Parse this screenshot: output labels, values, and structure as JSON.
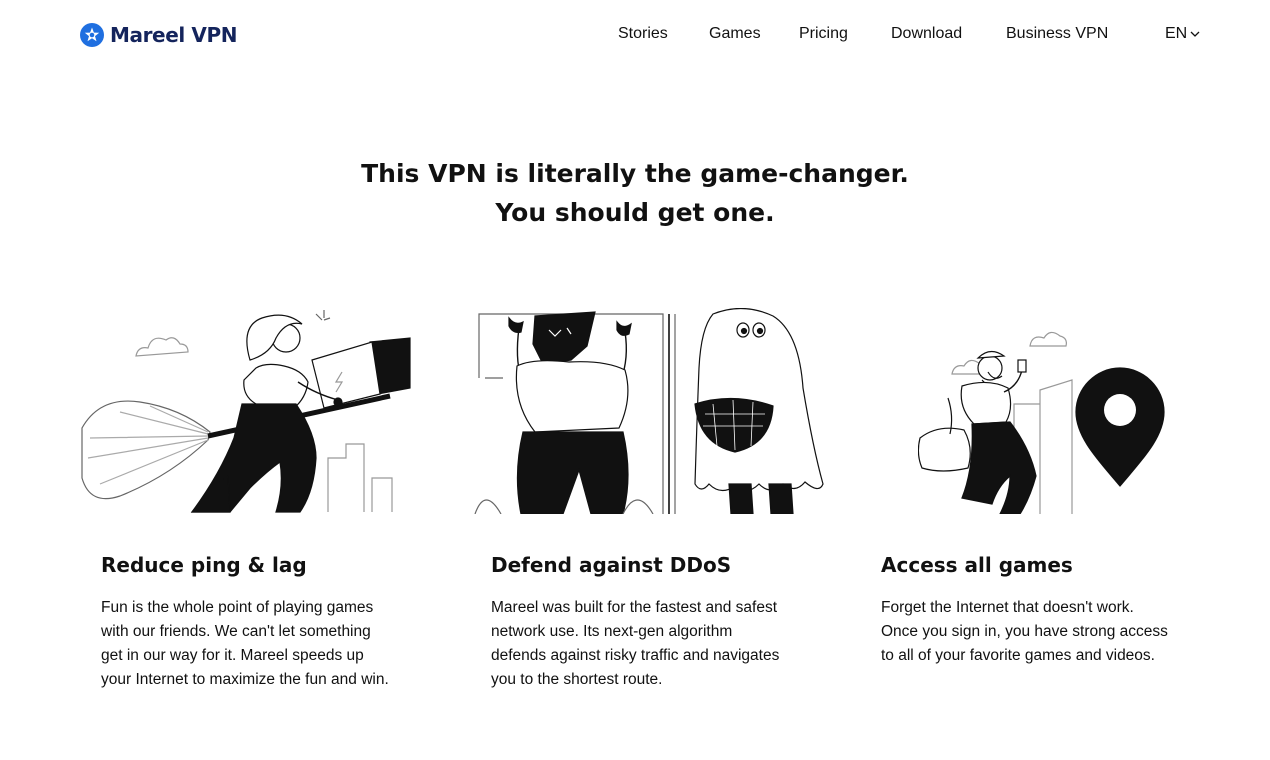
{
  "brand": {
    "name": "Mareel VPN",
    "logo_icon": "star-badge-icon",
    "color": "#1f6fe0",
    "text_color": "#14245c"
  },
  "nav": {
    "items": [
      "Stories",
      "Games",
      "Pricing",
      "Download",
      "Business VPN"
    ],
    "language": "EN",
    "language_icon": "chevron-down-icon"
  },
  "hero": {
    "line1": "This VPN is literally the game-changer.",
    "line2": "You should get one."
  },
  "features": [
    {
      "illustration": "witch-on-broom-illustration",
      "title": "Reduce ping & lag",
      "lines": [
        "Fun is the whole point of playing games",
        "with our friends. We can't let something",
        "get in our way for it. Mareel speeds up",
        "your Internet to maximize the fun and win."
      ]
    },
    {
      "illustration": "monster-and-ghost-illustration",
      "title": "Defend against DDoS",
      "lines": [
        "Mareel was built for the fastest and safest",
        "network use. Its next-gen algorithm",
        "defends against risky traffic and navigates",
        "you to the shortest route."
      ]
    },
    {
      "illustration": "traveler-with-map-pin-illustration",
      "title": "Access all games",
      "lines": [
        "Forget the Internet that doesn't work.",
        "Once you sign in, you have strong access",
        "to all of your favorite games and videos."
      ]
    }
  ]
}
